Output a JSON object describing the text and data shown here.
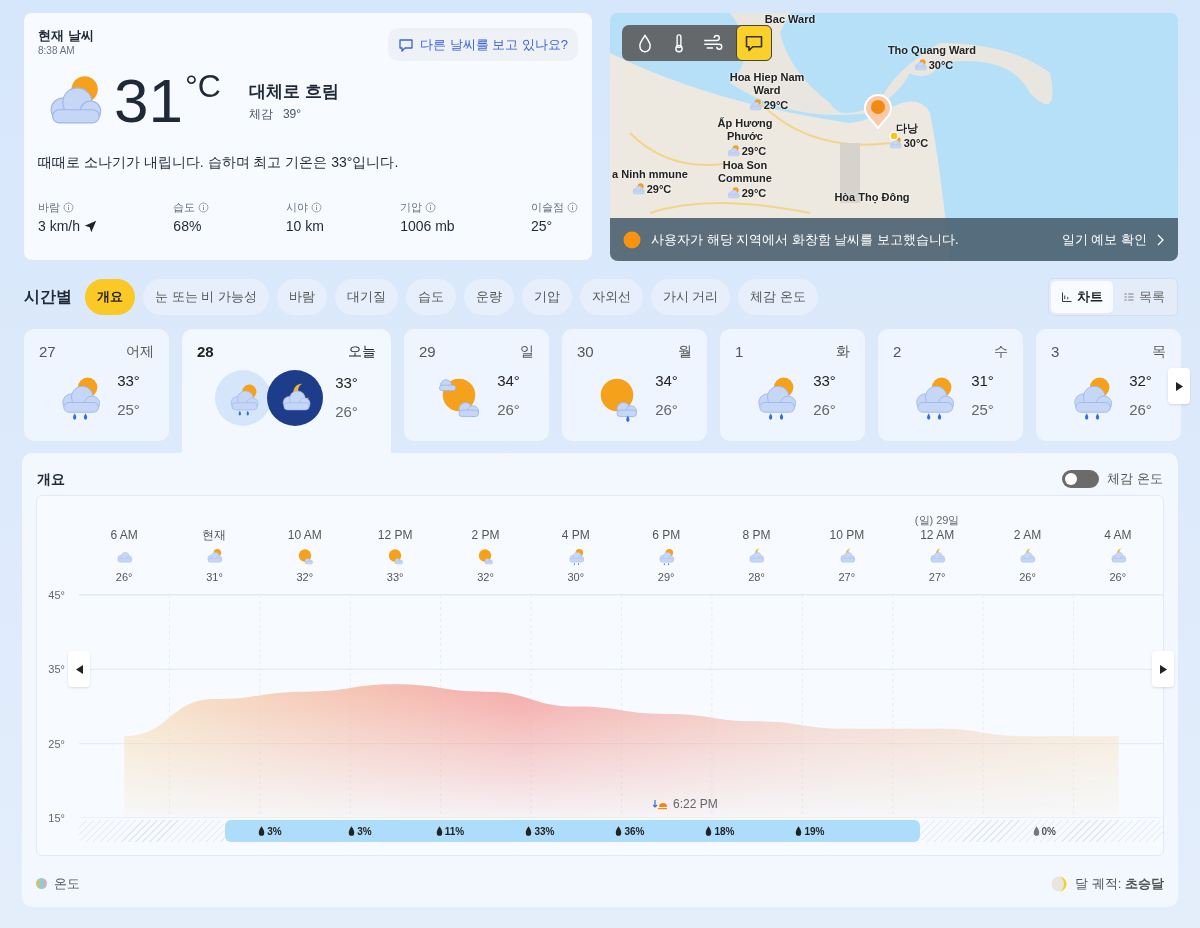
{
  "current": {
    "title": "현재 날씨",
    "time": "8:38 AM",
    "feedback_button": "다른 날씨를 보고 있나요?",
    "kind": "partly-cloudy",
    "temperature": "31",
    "unit": "°C",
    "condition": "대체로 흐림",
    "feels_like_label": "체감",
    "feels_like": "39°",
    "summary": "때때로 소나기가 내립니다. 습하며 최고 기온은 33°입니다.",
    "stats": [
      {
        "label": "바람",
        "value": "3 km/h",
        "kind": "wind"
      },
      {
        "label": "습도",
        "value": "68%",
        "kind": "plain"
      },
      {
        "label": "시야",
        "value": "10 km",
        "kind": "plain"
      },
      {
        "label": "기압",
        "value": "1006 mb",
        "kind": "plain"
      },
      {
        "label": "이슬점",
        "value": "25°",
        "kind": "plain"
      }
    ]
  },
  "map": {
    "layers": [
      {
        "kind": "precipitation",
        "selected": false
      },
      {
        "kind": "temperature",
        "selected": false
      },
      {
        "kind": "wind",
        "selected": false
      },
      {
        "kind": "reports",
        "selected": true
      }
    ],
    "labels": [
      {
        "name": "Bac Ward"
      },
      {
        "name": "Tho Quang Ward",
        "temp": "30°C"
      },
      {
        "name": "Hoa Hiep Nam Ward",
        "temp": "29°C"
      },
      {
        "name": "Ấp Hương Phước",
        "temp": "29°C"
      },
      {
        "name": "다낭",
        "temp": "30°C"
      },
      {
        "name": "a Ninh mmune",
        "temp": "29°C"
      },
      {
        "name": "Hoa Son Commune",
        "temp": "29°C"
      },
      {
        "name": "Hòa Thọ Đông"
      }
    ],
    "banner": "사용자가 해당 지역에서 화창함 날씨를 보고했습니다.",
    "banner_link": "일기 예보 확인"
  },
  "hourly": {
    "title": "시간별",
    "tabs": [
      {
        "label": "개요",
        "selected": true
      },
      {
        "label": "눈 또는 비 가능성",
        "selected": false
      },
      {
        "label": "바람",
        "selected": false
      },
      {
        "label": "대기질",
        "selected": false
      },
      {
        "label": "습도",
        "selected": false
      },
      {
        "label": "운량",
        "selected": false
      },
      {
        "label": "기압",
        "selected": false
      },
      {
        "label": "자외선",
        "selected": false
      },
      {
        "label": "가시 거리",
        "selected": false
      },
      {
        "label": "체감 온도",
        "selected": false
      }
    ],
    "views": [
      {
        "label": "차트",
        "kind": "chart",
        "selected": true
      },
      {
        "label": "목록",
        "kind": "list",
        "selected": false
      }
    ]
  },
  "days": [
    {
      "date": "27",
      "day": "어제",
      "high": "33°",
      "low": "25°",
      "icons": [
        {
          "kind": "rain-sun"
        }
      ],
      "selected": false
    },
    {
      "date": "28",
      "day": "오늘",
      "high": "33°",
      "low": "26°",
      "icons": [
        {
          "kind": "rain-sun"
        },
        {
          "kind": "moon-cloud"
        }
      ],
      "selected": true
    },
    {
      "date": "29",
      "day": "일",
      "high": "34°",
      "low": "26°",
      "icons": [
        {
          "kind": "sun-clouds"
        }
      ],
      "selected": false
    },
    {
      "date": "30",
      "day": "월",
      "high": "34°",
      "low": "26°",
      "icons": [
        {
          "kind": "sun-rain"
        }
      ],
      "selected": false
    },
    {
      "date": "1",
      "day": "화",
      "high": "33°",
      "low": "26°",
      "icons": [
        {
          "kind": "rain-sun"
        }
      ],
      "selected": false
    },
    {
      "date": "2",
      "day": "수",
      "high": "31°",
      "low": "25°",
      "icons": [
        {
          "kind": "rain-sun"
        }
      ],
      "selected": false
    },
    {
      "date": "3",
      "day": "목",
      "high": "32°",
      "low": "26°",
      "icons": [
        {
          "kind": "rain-sun"
        }
      ],
      "selected": false
    }
  ],
  "overview": {
    "title": "개요",
    "toggle": {
      "label": "체감 온도",
      "on": false
    },
    "hours": [
      {
        "kind": "cloudy",
        "temp": "26°"
      },
      {
        "kind": "partly-cloudy",
        "temp": "31°"
      },
      {
        "kind": "sun-cloud",
        "temp": "32°"
      },
      {
        "kind": "sun-cloud",
        "temp": "33°"
      },
      {
        "kind": "sun-cloud",
        "temp": "32°"
      },
      {
        "kind": "rain-sun",
        "temp": "30°"
      },
      {
        "kind": "rain-sun",
        "temp": "29°"
      },
      {
        "kind": "moon-cloud",
        "temp": "28°"
      },
      {
        "kind": "moon-cloud",
        "temp": "27°"
      },
      {
        "date": "(일) 29일",
        "kind": "moon-cloud",
        "temp": "27°"
      },
      {
        "kind": "moon-cloud",
        "temp": "26°"
      },
      {
        "kind": "moon-cloud",
        "temp": "26°"
      }
    ],
    "chart_data": {
      "type": "area",
      "categories": [
        "6 AM",
        "현재",
        "10 AM",
        "12 PM",
        "2 PM",
        "4 PM",
        "6 PM",
        "8 PM",
        "10 PM",
        "12 AM",
        "2 AM",
        "4 AM"
      ],
      "series": [
        {
          "name": "온도",
          "color": "#f4a3a0",
          "values": [
            26,
            31,
            32,
            33,
            32,
            30,
            29,
            28,
            27,
            27,
            26,
            26
          ]
        }
      ],
      "ylim": [
        15,
        45
      ],
      "yticks": [
        {
          "value": 15,
          "label": "15°"
        },
        {
          "value": 25,
          "label": "25°"
        },
        {
          "value": 35,
          "label": "35°"
        },
        {
          "value": 45,
          "label": "45°"
        }
      ]
    },
    "sunset": "6:22 PM",
    "precipitation": [
      {
        "kind": "unavailable"
      },
      {
        "kind": "forecast",
        "values": [
          "3%",
          "3%",
          "11%",
          "33%",
          "36%",
          "18%",
          "19%"
        ]
      },
      {
        "kind": "unavailable",
        "values": [
          "0%"
        ]
      }
    ],
    "moon": "달 궤적: **초승달**"
  }
}
